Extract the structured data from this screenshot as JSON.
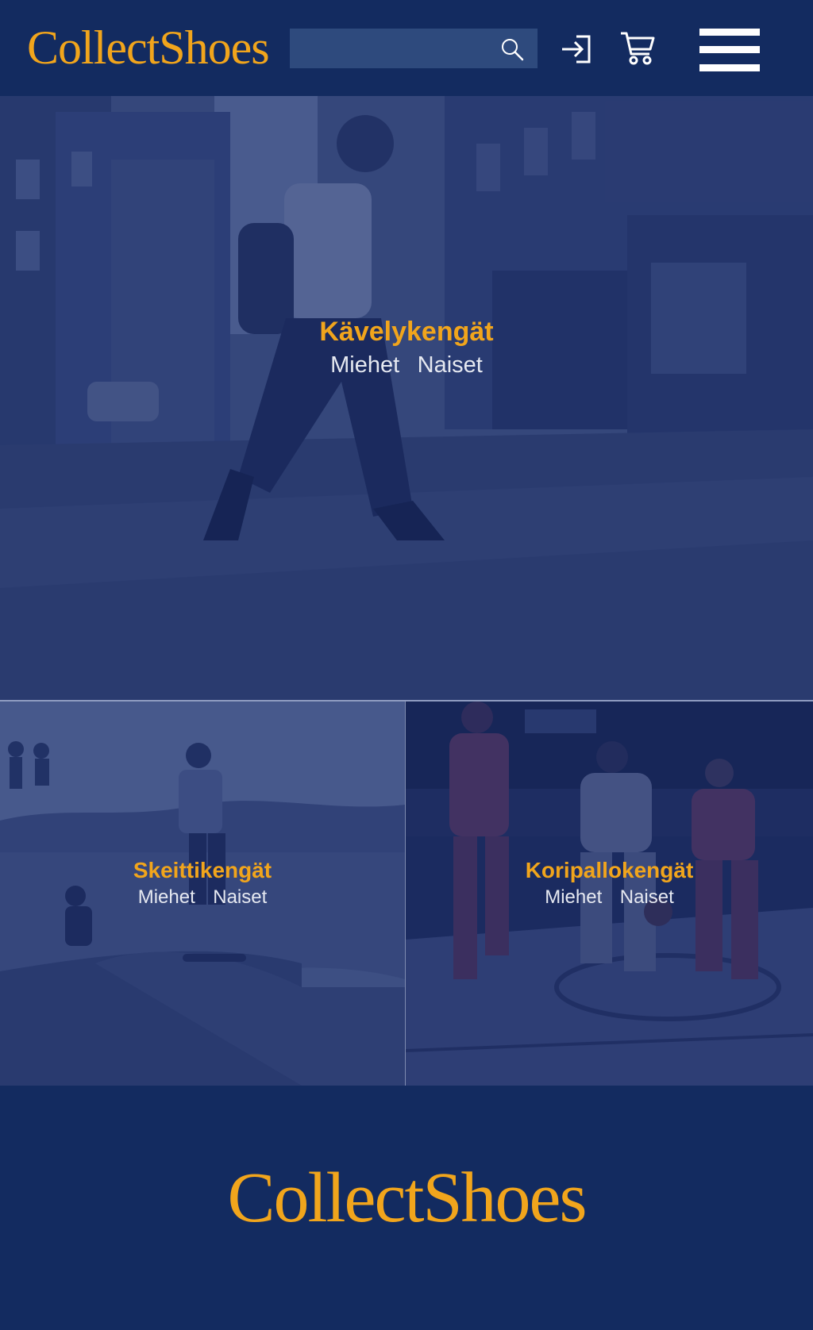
{
  "brand": {
    "name": "CollectShoes",
    "accent_color": "#f1a51c",
    "background_color": "#132b60"
  },
  "header": {
    "search": {
      "placeholder": "",
      "value": "",
      "icon": "search-icon"
    },
    "icons": {
      "login": "login-icon",
      "cart": "cart-icon",
      "menu": "hamburger-menu-icon"
    }
  },
  "categories": [
    {
      "title": "Kävelykengät",
      "photo": "man walking across city street",
      "links": [
        "Miehet",
        "Naiset"
      ]
    },
    {
      "title": "Skeittikengät",
      "photo": "skateboarder in skatepark bowl",
      "links": [
        "Miehet",
        "Naiset"
      ]
    },
    {
      "title": "Koripallokengät",
      "photo": "basketball players dribbling on court",
      "links": [
        "Miehet",
        "Naiset"
      ]
    }
  ],
  "footer": {
    "logo": "CollectShoes"
  }
}
